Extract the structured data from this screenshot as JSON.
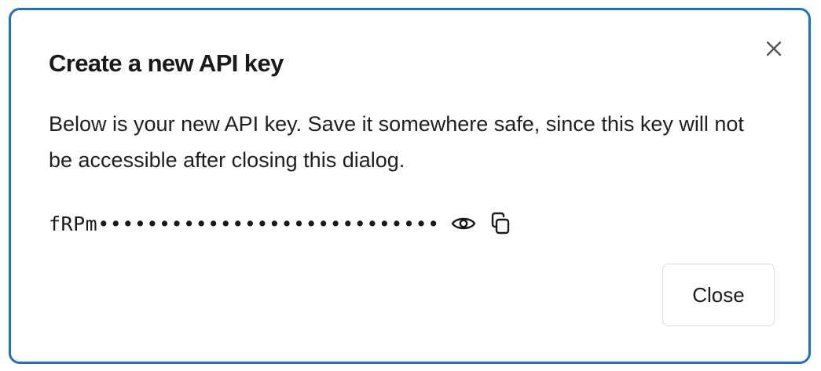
{
  "dialog": {
    "title": "Create a new API key",
    "description": "Below is your new API key. Save it somewhere safe, since this key will not be accessible after closing this dialog.",
    "api_key_display": "fRPm••••••••••••••••••••••••••••",
    "close_button_label": "Close",
    "icons": {
      "dismiss": "close-x-icon",
      "reveal": "eye-icon",
      "copy": "copy-icon"
    },
    "colors": {
      "border": "#1f6fc4",
      "text": "#1a1a1a",
      "button_border": "#dcdcdc"
    }
  }
}
